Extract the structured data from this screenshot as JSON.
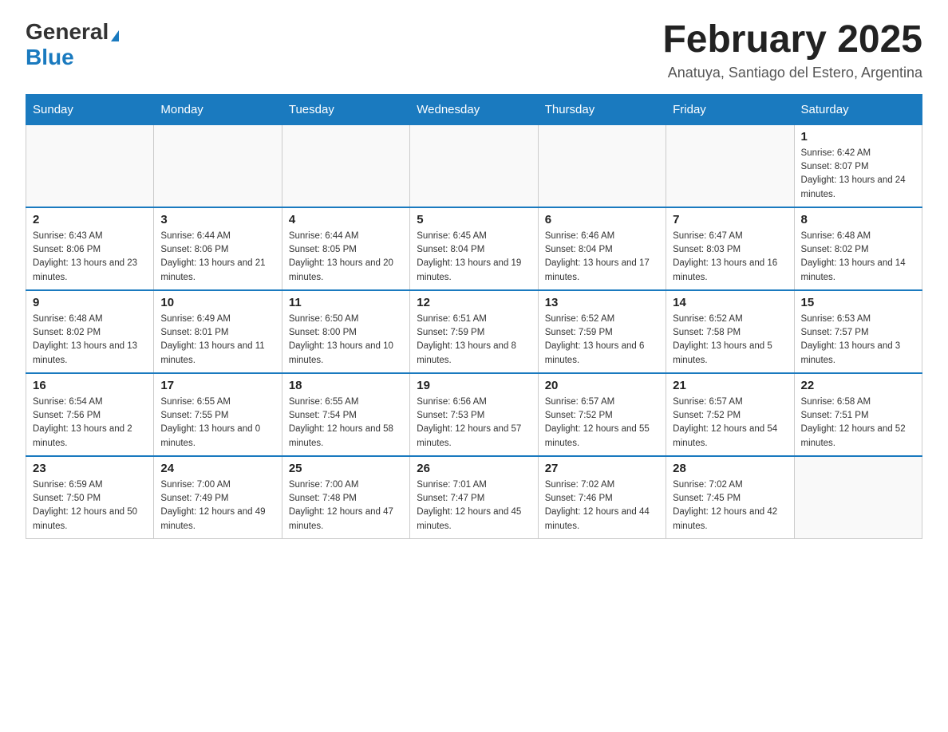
{
  "logo": {
    "general": "General",
    "blue": "Blue"
  },
  "title": "February 2025",
  "location": "Anatuya, Santiago del Estero, Argentina",
  "days_of_week": [
    "Sunday",
    "Monday",
    "Tuesday",
    "Wednesday",
    "Thursday",
    "Friday",
    "Saturday"
  ],
  "weeks": [
    [
      {
        "day": "",
        "info": ""
      },
      {
        "day": "",
        "info": ""
      },
      {
        "day": "",
        "info": ""
      },
      {
        "day": "",
        "info": ""
      },
      {
        "day": "",
        "info": ""
      },
      {
        "day": "",
        "info": ""
      },
      {
        "day": "1",
        "info": "Sunrise: 6:42 AM\nSunset: 8:07 PM\nDaylight: 13 hours and 24 minutes."
      }
    ],
    [
      {
        "day": "2",
        "info": "Sunrise: 6:43 AM\nSunset: 8:06 PM\nDaylight: 13 hours and 23 minutes."
      },
      {
        "day": "3",
        "info": "Sunrise: 6:44 AM\nSunset: 8:06 PM\nDaylight: 13 hours and 21 minutes."
      },
      {
        "day": "4",
        "info": "Sunrise: 6:44 AM\nSunset: 8:05 PM\nDaylight: 13 hours and 20 minutes."
      },
      {
        "day": "5",
        "info": "Sunrise: 6:45 AM\nSunset: 8:04 PM\nDaylight: 13 hours and 19 minutes."
      },
      {
        "day": "6",
        "info": "Sunrise: 6:46 AM\nSunset: 8:04 PM\nDaylight: 13 hours and 17 minutes."
      },
      {
        "day": "7",
        "info": "Sunrise: 6:47 AM\nSunset: 8:03 PM\nDaylight: 13 hours and 16 minutes."
      },
      {
        "day": "8",
        "info": "Sunrise: 6:48 AM\nSunset: 8:02 PM\nDaylight: 13 hours and 14 minutes."
      }
    ],
    [
      {
        "day": "9",
        "info": "Sunrise: 6:48 AM\nSunset: 8:02 PM\nDaylight: 13 hours and 13 minutes."
      },
      {
        "day": "10",
        "info": "Sunrise: 6:49 AM\nSunset: 8:01 PM\nDaylight: 13 hours and 11 minutes."
      },
      {
        "day": "11",
        "info": "Sunrise: 6:50 AM\nSunset: 8:00 PM\nDaylight: 13 hours and 10 minutes."
      },
      {
        "day": "12",
        "info": "Sunrise: 6:51 AM\nSunset: 7:59 PM\nDaylight: 13 hours and 8 minutes."
      },
      {
        "day": "13",
        "info": "Sunrise: 6:52 AM\nSunset: 7:59 PM\nDaylight: 13 hours and 6 minutes."
      },
      {
        "day": "14",
        "info": "Sunrise: 6:52 AM\nSunset: 7:58 PM\nDaylight: 13 hours and 5 minutes."
      },
      {
        "day": "15",
        "info": "Sunrise: 6:53 AM\nSunset: 7:57 PM\nDaylight: 13 hours and 3 minutes."
      }
    ],
    [
      {
        "day": "16",
        "info": "Sunrise: 6:54 AM\nSunset: 7:56 PM\nDaylight: 13 hours and 2 minutes."
      },
      {
        "day": "17",
        "info": "Sunrise: 6:55 AM\nSunset: 7:55 PM\nDaylight: 13 hours and 0 minutes."
      },
      {
        "day": "18",
        "info": "Sunrise: 6:55 AM\nSunset: 7:54 PM\nDaylight: 12 hours and 58 minutes."
      },
      {
        "day": "19",
        "info": "Sunrise: 6:56 AM\nSunset: 7:53 PM\nDaylight: 12 hours and 57 minutes."
      },
      {
        "day": "20",
        "info": "Sunrise: 6:57 AM\nSunset: 7:52 PM\nDaylight: 12 hours and 55 minutes."
      },
      {
        "day": "21",
        "info": "Sunrise: 6:57 AM\nSunset: 7:52 PM\nDaylight: 12 hours and 54 minutes."
      },
      {
        "day": "22",
        "info": "Sunrise: 6:58 AM\nSunset: 7:51 PM\nDaylight: 12 hours and 52 minutes."
      }
    ],
    [
      {
        "day": "23",
        "info": "Sunrise: 6:59 AM\nSunset: 7:50 PM\nDaylight: 12 hours and 50 minutes."
      },
      {
        "day": "24",
        "info": "Sunrise: 7:00 AM\nSunset: 7:49 PM\nDaylight: 12 hours and 49 minutes."
      },
      {
        "day": "25",
        "info": "Sunrise: 7:00 AM\nSunset: 7:48 PM\nDaylight: 12 hours and 47 minutes."
      },
      {
        "day": "26",
        "info": "Sunrise: 7:01 AM\nSunset: 7:47 PM\nDaylight: 12 hours and 45 minutes."
      },
      {
        "day": "27",
        "info": "Sunrise: 7:02 AM\nSunset: 7:46 PM\nDaylight: 12 hours and 44 minutes."
      },
      {
        "day": "28",
        "info": "Sunrise: 7:02 AM\nSunset: 7:45 PM\nDaylight: 12 hours and 42 minutes."
      },
      {
        "day": "",
        "info": ""
      }
    ]
  ]
}
